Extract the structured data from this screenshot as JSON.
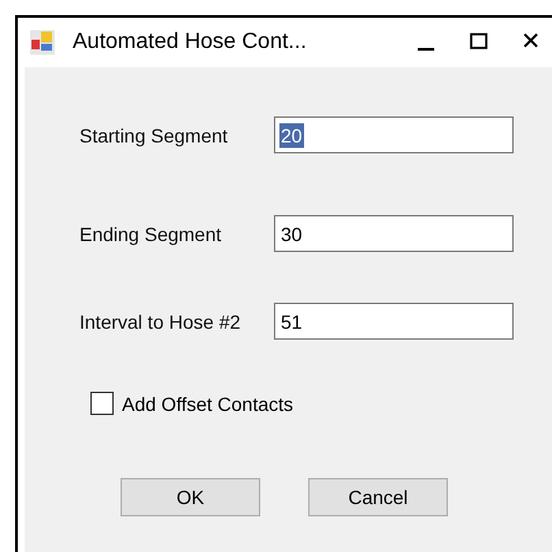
{
  "window": {
    "title": "Automated Hose Cont..."
  },
  "fields": [
    {
      "label": "Starting Segment",
      "value": "20",
      "text_selected": true
    },
    {
      "label": "Ending Segment",
      "value": "30",
      "text_selected": false
    },
    {
      "label": "Interval to Hose #2",
      "value": "51",
      "text_selected": false
    }
  ],
  "checkbox": {
    "label": "Add Offset Contacts",
    "checked": false
  },
  "buttons": [
    "OK",
    "Cancel"
  ]
}
